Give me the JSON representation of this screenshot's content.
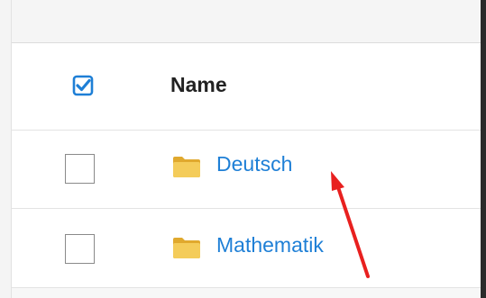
{
  "table": {
    "header": {
      "name_label": "Name",
      "select_all_icon": "checked-checkbox-icon"
    },
    "rows": [
      {
        "name": "Deutsch",
        "icon": "folder-icon",
        "checked": false
      },
      {
        "name": "Mathematik",
        "icon": "folder-icon",
        "checked": false
      }
    ]
  },
  "annotation": {
    "arrow_color": "#e8201f",
    "arrow_icon": "red-arrow-icon"
  },
  "colors": {
    "link": "#1e7fd6",
    "accent": "#1e7fd6",
    "folder": "#f1c24b"
  }
}
